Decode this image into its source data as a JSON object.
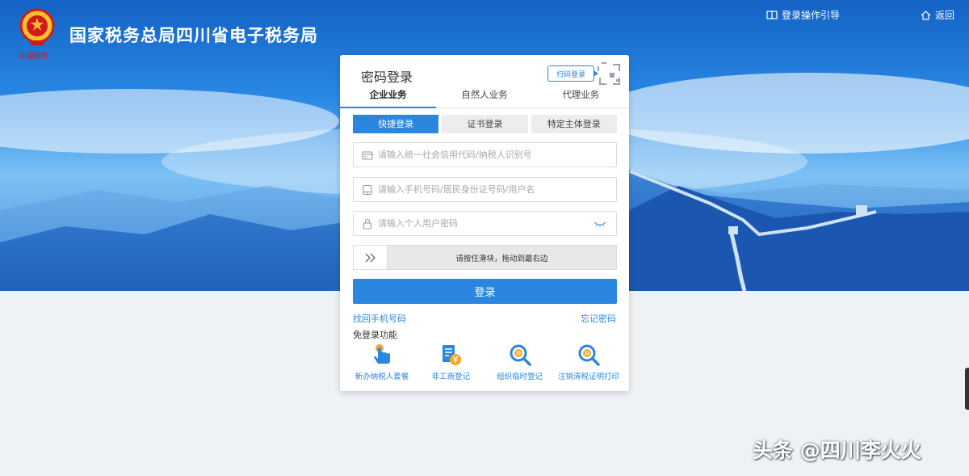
{
  "header": {
    "site_title": "国家税务总局四川省电子税务局",
    "emblem_caption": "中国税务",
    "guide_link": "登录操作引导",
    "back_link": "返回"
  },
  "login": {
    "title": "密码登录",
    "qr_badge": "扫码登录",
    "main_tabs": [
      {
        "label": "企业业务",
        "active": true
      },
      {
        "label": "自然人业务",
        "active": false
      },
      {
        "label": "代理业务",
        "active": false
      }
    ],
    "sub_tabs": [
      {
        "label": "快捷登录",
        "active": true
      },
      {
        "label": "证书登录",
        "active": false
      },
      {
        "label": "特定主体登录",
        "active": false
      }
    ],
    "fields": {
      "credit_code_placeholder": "请输入统一社会信用代码/纳税人识别号",
      "phone_placeholder": "请输入手机号码/居民身份证号码/用户名",
      "password_placeholder": "请输入个人用户密码"
    },
    "slider_text": "请按住滑块，拖动到最右边",
    "login_button": "登录",
    "find_phone_link": "找回手机号码",
    "forgot_password_link": "忘记密码",
    "nologin_label": "免登录功能",
    "quick_items": [
      {
        "label": "新办纳税人套餐",
        "icon": "hand-pointer-icon"
      },
      {
        "label": "非工商登记",
        "icon": "document-yen-icon"
      },
      {
        "label": "组织临时登记",
        "icon": "search-arrows-icon"
      },
      {
        "label": "注销清税证明打印",
        "icon": "search-arrows-icon"
      }
    ]
  },
  "watermark": "头条 @四川李火火",
  "colors": {
    "accent": "#2b86e0",
    "banner_top": "#1565c8",
    "background": "#eef2f5",
    "orange": "#f5a623"
  }
}
